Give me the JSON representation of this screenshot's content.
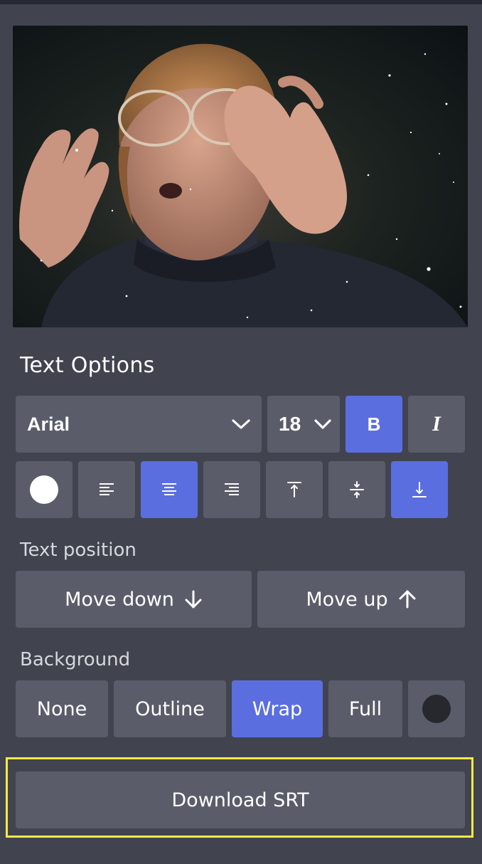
{
  "video": {
    "description_icon": "video-preview"
  },
  "text_options": {
    "title": "Text Options",
    "font": {
      "value": "Arial"
    },
    "size": {
      "value": "18"
    },
    "bold_label": "B",
    "italic_label": "I",
    "text_color": "#ffffff"
  },
  "text_position": {
    "label": "Text position",
    "move_down": "Move down",
    "move_up": "Move up"
  },
  "background": {
    "label": "Background",
    "options": [
      "None",
      "Outline",
      "Wrap",
      "Full"
    ],
    "selected": "Wrap",
    "color": "#26282e"
  },
  "download_label": "Download SRT",
  "colors": {
    "accent": "#5b6ee0",
    "panel": "#41444f",
    "button": "#5a5d69",
    "highlight": "#f3ea48"
  }
}
